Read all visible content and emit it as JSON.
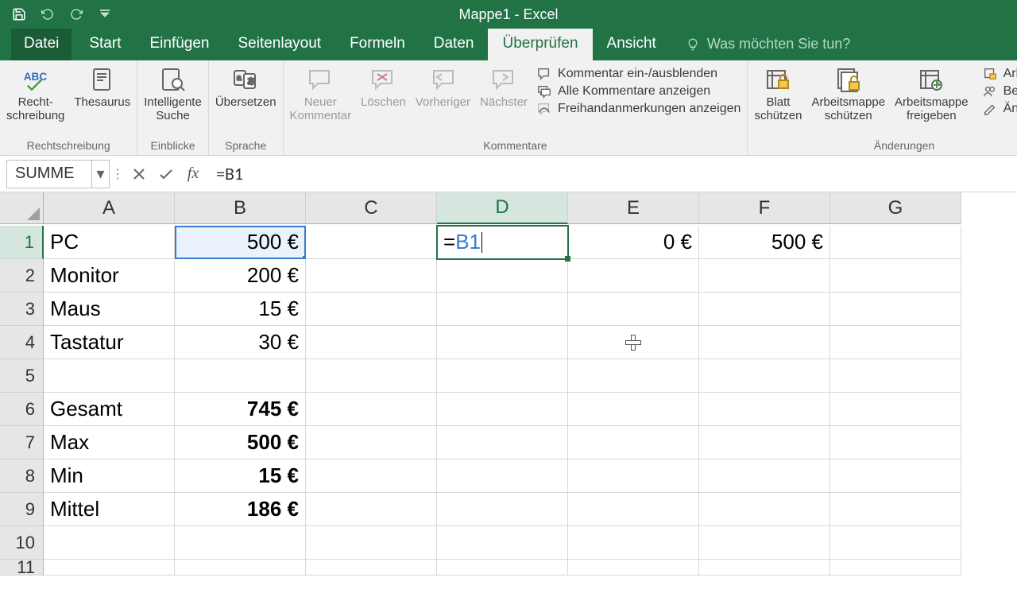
{
  "app": {
    "title": "Mappe1 - Excel"
  },
  "tabs": {
    "file": "Datei",
    "items": [
      "Start",
      "Einfügen",
      "Seitenlayout",
      "Formeln",
      "Daten",
      "Überprüfen",
      "Ansicht"
    ],
    "active_index": 5,
    "tell_me": "Was möchten Sie tun?"
  },
  "ribbon": {
    "proofing": {
      "spell": "Recht-\nschreibung",
      "thesaurus": "Thesaurus",
      "group": "Rechtschreibung"
    },
    "insights": {
      "smart": "Intelligente\nSuche",
      "group": "Einblicke"
    },
    "language": {
      "translate": "Übersetzen",
      "group": "Sprache"
    },
    "comments": {
      "new": "Neuer\nKommentar",
      "delete": "Löschen",
      "prev": "Vorheriger",
      "next": "Nächster",
      "toggle": "Kommentar ein-/ausblenden",
      "showall": "Alle Kommentare anzeigen",
      "ink": "Freihandanmerkungen anzeigen",
      "group": "Kommentare"
    },
    "protect": {
      "sheet": "Blatt\nschützen",
      "workbook": "Arbeitsmappe\nschützen",
      "share": "Arbeitsmappe\nfreigeben",
      "group": "Änderungen",
      "side1": "Arbeitsm",
      "side2": "Benutzer",
      "side3": "Änderun"
    }
  },
  "fbar": {
    "namebox": "SUMME",
    "formula": "=B1"
  },
  "grid": {
    "cols": [
      "A",
      "B",
      "C",
      "D",
      "E",
      "F",
      "G"
    ],
    "active_col": "D",
    "active_row": 1,
    "rows": [
      {
        "a": "PC",
        "b": "500 €",
        "d_edit": {
          "eq": "=",
          "ref": "B1"
        },
        "e": "0 €",
        "f": "500 €"
      },
      {
        "a": "Monitor",
        "b": "200 €"
      },
      {
        "a": "Maus",
        "b": "15 €"
      },
      {
        "a": "Tastatur",
        "b": "30 €"
      },
      {
        "a": "",
        "b": ""
      },
      {
        "a": "Gesamt",
        "b": "745 €",
        "bold": true
      },
      {
        "a": "Max",
        "b": "500 €",
        "bold": true
      },
      {
        "a": "Min",
        "b": "15 €",
        "bold": true
      },
      {
        "a": "Mittel",
        "b": "186 €",
        "bold": true
      },
      {
        "a": "",
        "b": ""
      },
      {
        "a": "",
        "b": ""
      }
    ]
  }
}
